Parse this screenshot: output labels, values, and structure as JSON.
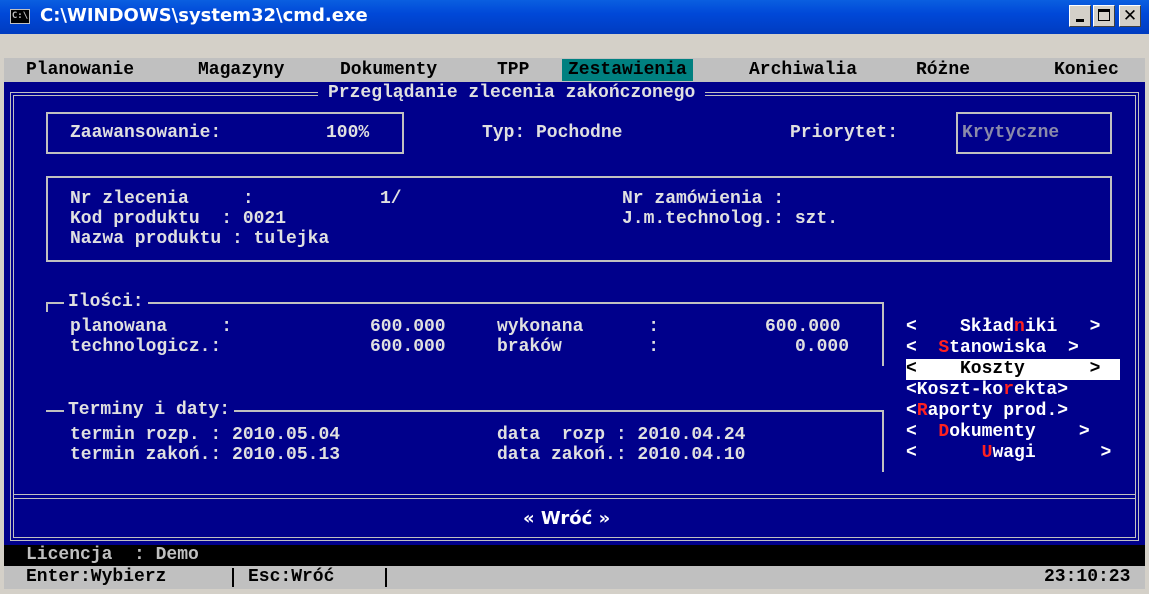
{
  "window": {
    "title": "C:\\WINDOWS\\system32\\cmd.exe",
    "icon": "cmd-icon"
  },
  "menu": [
    "Planowanie",
    "Magazyny",
    "Dokumenty",
    "TPP",
    "Zestawienia",
    "Archiwalia",
    "Różne",
    "Koniec"
  ],
  "menu_active": "Zestawienia",
  "frame_title": "Przeglądanie zlecenia zakończonego",
  "status_box": {
    "progress_label": "Zaawansowanie:",
    "progress_value": "100%",
    "type_label": "Typ: Pochodne",
    "priority_label": "Priorytet:",
    "priority_value": "Krytyczne"
  },
  "order": {
    "nr_label": "Nr zlecenia     :",
    "nr_value": "1/",
    "code_label": "Kod produktu  : 0021",
    "name_label": "Nazwa produktu : tulejka",
    "order_nr": "Nr zamówienia :",
    "unit": "J.m.technolog.: szt."
  },
  "quantities": {
    "title": "Ilości:",
    "planned_label": "planowana     :",
    "planned_value": "600.000",
    "tech_label": "technologicz.:",
    "tech_value": "600.000",
    "done_label": "wykonana      :",
    "done_value": "600.000",
    "reject_label": "braków        :",
    "reject_value": "0.000"
  },
  "dates": {
    "title": "Terminy i daty:",
    "start_term": "termin rozp. : 2010.05.04",
    "end_term": "termin zakoń.: 2010.05.13",
    "start_date": "data  rozp : 2010.04.24",
    "end_date": "data zakoń.: 2010.04.10"
  },
  "side_buttons": [
    {
      "pre": "<    Skład",
      "hk": "n",
      "post": "iki   >"
    },
    {
      "pre": "<  ",
      "hk": "S",
      "post": "tanowiska  >"
    },
    {
      "pre": "<    Koszty      >",
      "hk": "",
      "post": "",
      "selected": true
    },
    {
      "pre": "<Koszt-ko",
      "hk": "r",
      "post": "ekta>"
    },
    {
      "pre": "<",
      "hk": "R",
      "post": "aporty prod.>"
    },
    {
      "pre": "<  ",
      "hk": "D",
      "post": "okumenty    >"
    },
    {
      "pre": "<      ",
      "hk": "U",
      "post": "wagi      >"
    }
  ],
  "back_button": "« Wróć »",
  "status": {
    "license": "Licencja  : Demo",
    "enter": "Enter:Wybierz",
    "esc": "Esc:Wróć",
    "clock": "23:10:23"
  }
}
